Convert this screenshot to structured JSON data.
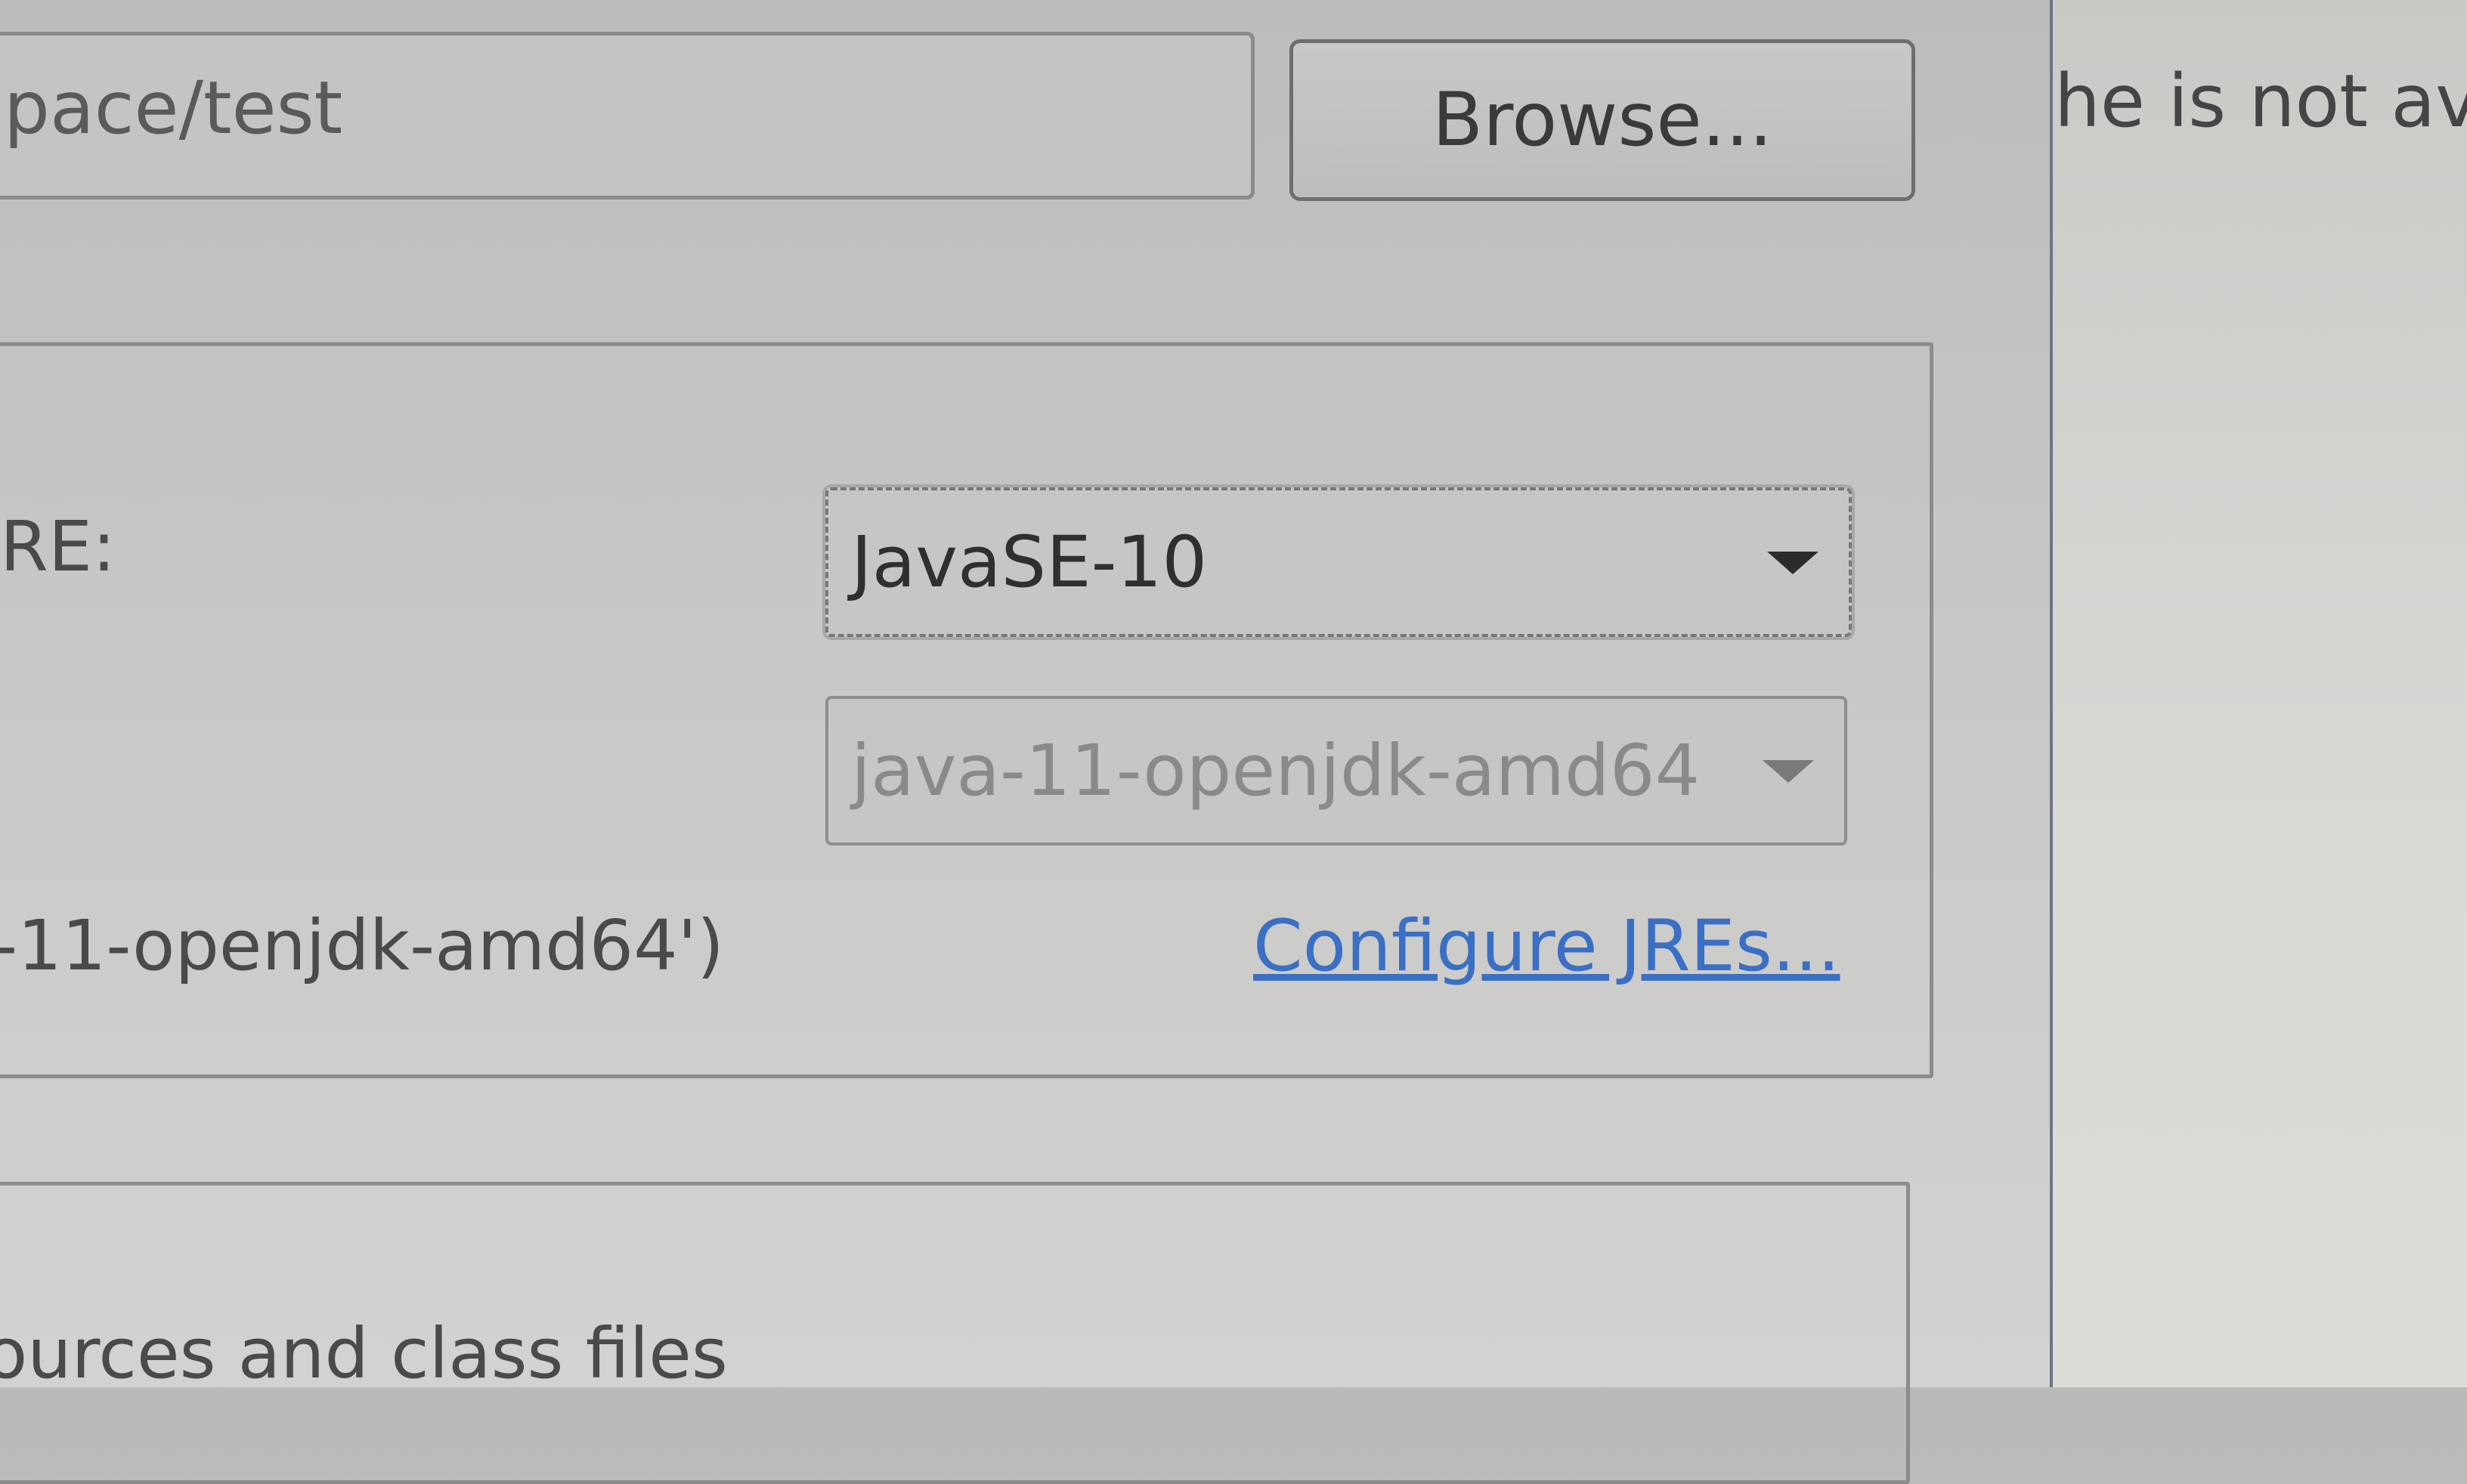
{
  "location": {
    "value": "pace/test",
    "browse_label": "Browse..."
  },
  "background_text": "he is not av",
  "jre_group": {
    "label": "RE:",
    "execution_env_combo": {
      "value": "JavaSE-10"
    },
    "project_jre_combo": {
      "value": "java-11-openjdk-amd64",
      "disabled": true
    },
    "default_jre_text": "-11-openjdk-amd64')",
    "configure_link": "Configure JREs..."
  },
  "layout_group": {
    "partial_text": "ources and class files"
  },
  "colors": {
    "link": "#3a6fc4",
    "dialog_border": "#6f7488"
  }
}
